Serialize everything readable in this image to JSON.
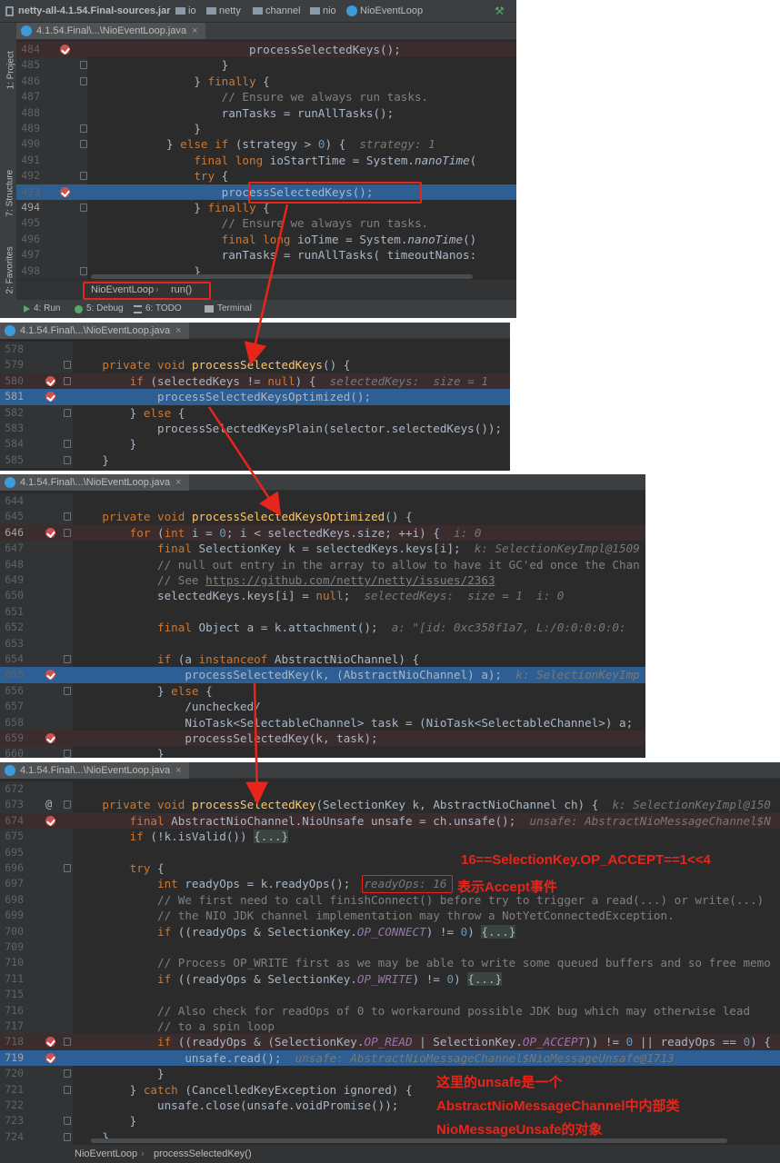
{
  "nav": {
    "items": [
      "netty-all-4.1.54.Final-sources.jar",
      "io",
      "netty",
      "channel",
      "nio",
      "NioEventLoop"
    ]
  },
  "side": {
    "project": "1: Project",
    "structure": "7: Structure",
    "favorites": "2: Favorites"
  },
  "bottom": {
    "run": "4: Run",
    "debug": "5: Debug",
    "todo": "6: TODO",
    "terminal": "Terminal"
  },
  "tab_title": "4.1.54.Final\\...\\NioEventLoop.java",
  "panel1": {
    "crumb": [
      "NioEventLoop",
      "run()"
    ],
    "lines": [
      {
        "n": "484",
        "t": "                        processSelectedKeys();"
      },
      {
        "n": "485",
        "t": "                    }"
      },
      {
        "n": "486",
        "t": "                } finally {"
      },
      {
        "n": "487",
        "t": "                    // Ensure we always run tasks."
      },
      {
        "n": "488",
        "t": "                    ranTasks = runAllTasks();"
      },
      {
        "n": "489",
        "t": "                }"
      },
      {
        "n": "490",
        "t": "            } else if (strategy > 0) {  strategy: 1"
      },
      {
        "n": "491",
        "t": "                final long ioStartTime = System.nanoTime("
      },
      {
        "n": "492",
        "t": "                try {"
      },
      {
        "n": "493",
        "t": "                    processSelectedKeys();"
      },
      {
        "n": "494",
        "t": "                } finally {"
      },
      {
        "n": "495",
        "t": "                    // Ensure we always run tasks."
      },
      {
        "n": "496",
        "t": "                    final long ioTime = System.nanoTime()"
      },
      {
        "n": "497",
        "t": "                    ranTasks = runAllTasks( timeoutNanos: "
      },
      {
        "n": "498",
        "t": "                }"
      }
    ]
  },
  "panel2": {
    "lines": [
      {
        "n": "578",
        "t": ""
      },
      {
        "n": "579",
        "t": "    private void processSelectedKeys() {"
      },
      {
        "n": "580",
        "t": "        if (selectedKeys != null) {  selectedKeys:  size = 1"
      },
      {
        "n": "581",
        "t": "            processSelectedKeysOptimized();"
      },
      {
        "n": "582",
        "t": "        } else {"
      },
      {
        "n": "583",
        "t": "            processSelectedKeysPlain(selector.selectedKeys());"
      },
      {
        "n": "584",
        "t": "        }"
      },
      {
        "n": "585",
        "t": "    }"
      }
    ]
  },
  "panel3": {
    "lines": [
      {
        "n": "644",
        "t": ""
      },
      {
        "n": "645",
        "t": "    private void processSelectedKeysOptimized() {"
      },
      {
        "n": "646",
        "t": "        for (int i = 0; i < selectedKeys.size; ++i) {  i: 0"
      },
      {
        "n": "647",
        "t": "            final SelectionKey k = selectedKeys.keys[i];  k: SelectionKeyImpl@1509"
      },
      {
        "n": "648",
        "t": "            // null out entry in the array to allow to have it GC'ed once the Chan"
      },
      {
        "n": "649",
        "t": "            // See https://github.com/netty/netty/issues/2363"
      },
      {
        "n": "650",
        "t": "            selectedKeys.keys[i] = null;  selectedKeys:  size = 1  i: 0"
      },
      {
        "n": "651",
        "t": ""
      },
      {
        "n": "652",
        "t": "            final Object a = k.attachment();  a: \"[id: 0xc358f1a7, L:/0:0:0:0:0:"
      },
      {
        "n": "653",
        "t": ""
      },
      {
        "n": "654",
        "t": "            if (a instanceof AbstractNioChannel) {"
      },
      {
        "n": "655",
        "t": "                processSelectedKey(k, (AbstractNioChannel) a);  k: SelectionKeyImp"
      },
      {
        "n": "656",
        "t": "            } else {"
      },
      {
        "n": "657",
        "t": "                /unchecked/"
      },
      {
        "n": "658",
        "t": "                NioTask<SelectableChannel> task = (NioTask<SelectableChannel>) a;"
      },
      {
        "n": "659",
        "t": "                processSelectedKey(k, task);"
      },
      {
        "n": "660",
        "t": "            }"
      }
    ]
  },
  "panel4": {
    "crumb": [
      "NioEventLoop",
      "processSelectedKey()"
    ],
    "lines": [
      {
        "n": "672",
        "t": ""
      },
      {
        "n": "673",
        "t": "    private void processSelectedKey(SelectionKey k, AbstractNioChannel ch) {  k: SelectionKeyImpl@150"
      },
      {
        "n": "674",
        "t": "        final AbstractNioChannel.NioUnsafe unsafe = ch.unsafe();  unsafe: AbstractNioMessageChannel$N"
      },
      {
        "n": "675",
        "t": "        if (!k.isValid()) {...}"
      },
      {
        "n": "695",
        "t": ""
      },
      {
        "n": "696",
        "t": "        try {"
      },
      {
        "n": "697",
        "t": "            int readyOps = k.readyOps();  readyOps: 16"
      },
      {
        "n": "698",
        "t": "            // We first need to call finishConnect() before try to trigger a read(...) or write(...)"
      },
      {
        "n": "699",
        "t": "            // the NIO JDK channel implementation may throw a NotYetConnectedException."
      },
      {
        "n": "700",
        "t": "            if ((readyOps & SelectionKey.OP_CONNECT) != 0) {...}"
      },
      {
        "n": "709",
        "t": ""
      },
      {
        "n": "710",
        "t": "            // Process OP_WRITE first as we may be able to write some queued buffers and so free memo"
      },
      {
        "n": "711",
        "t": "            if ((readyOps & SelectionKey.OP_WRITE) != 0) {...}"
      },
      {
        "n": "715",
        "t": ""
      },
      {
        "n": "716",
        "t": "            // Also check for readOps of 0 to workaround possible JDK bug which may otherwise lead"
      },
      {
        "n": "717",
        "t": "            // to a spin loop"
      },
      {
        "n": "718",
        "t": "            if ((readyOps & (SelectionKey.OP_READ | SelectionKey.OP_ACCEPT)) != 0 || readyOps == 0) {"
      },
      {
        "n": "719",
        "t": "                unsafe.read();  unsafe: AbstractNioMessageChannel$NioMessageUnsafe@1713"
      },
      {
        "n": "720",
        "t": "            }"
      },
      {
        "n": "721",
        "t": "        } catch (CancelledKeyException ignored) {"
      },
      {
        "n": "722",
        "t": "            unsafe.close(unsafe.voidPromise());"
      },
      {
        "n": "723",
        "t": "        }"
      },
      {
        "n": "724",
        "t": "    }"
      }
    ]
  },
  "notes": {
    "accept_eq": "16==SelectionKey.OP_ACCEPT==1<<4",
    "accept_desc": "表示Accept事件",
    "unsafe_1": "这里的unsafe是一个",
    "unsafe_2": "AbstractNioMessageChannel中内部类",
    "unsafe_3": "NioMessageUnsafe的对象"
  },
  "colors": {
    "accent_red": "#e8251a",
    "selection": "#2d5e94",
    "breakpoint": "#c75450"
  }
}
